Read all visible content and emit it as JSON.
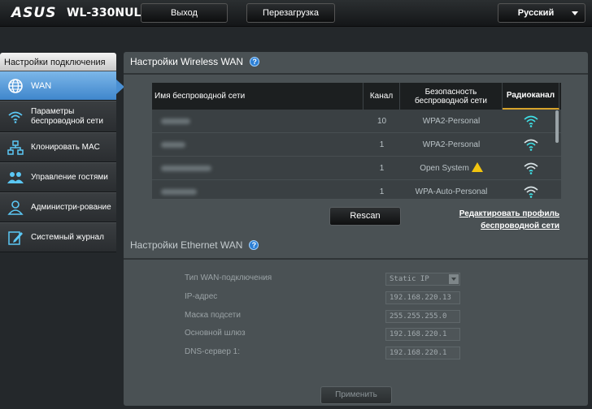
{
  "brand": {
    "logo": "ASUS",
    "model": "WL-330NUL"
  },
  "topbar": {
    "logout": "Выход",
    "reboot": "Перезагрузка",
    "language": "Русский"
  },
  "sidebar": {
    "title": "Настройки подключения",
    "items": [
      {
        "label": "WAN",
        "icon": "globe-icon",
        "active": true
      },
      {
        "label": "Параметры беспроводной сети",
        "icon": "wifi-icon"
      },
      {
        "label": "Клонировать MAC",
        "icon": "network-icon"
      },
      {
        "label": "Управление гостями",
        "icon": "users-icon"
      },
      {
        "label": "Администри-рование",
        "icon": "admin-icon"
      },
      {
        "label": "Системный журнал",
        "icon": "log-icon"
      }
    ]
  },
  "wireless": {
    "title": "Настройки Wireless WAN",
    "columns": [
      "Имя беспроводной сети",
      "Канал",
      "Безопасность беспроводной сети",
      "Радиоканал"
    ],
    "rows": [
      {
        "channel": "10",
        "security": "WPA2-Personal",
        "warning": false
      },
      {
        "channel": "1",
        "security": "WPA2-Personal",
        "warning": false
      },
      {
        "channel": "1",
        "security": "Open System",
        "warning": true
      },
      {
        "channel": "1",
        "security": "WPA-Auto-Personal",
        "warning": false
      }
    ],
    "rescan": "Rescan",
    "edit_link": "Редактировать профиль беспроводной сети"
  },
  "ethernet": {
    "title": "Настройки Ethernet WAN",
    "fields": [
      {
        "label": "Тип WAN-подключения",
        "value": "Static IP",
        "type": "select"
      },
      {
        "label": "IP-адрес",
        "value": "192.168.220.13"
      },
      {
        "label": "Маска подсети",
        "value": "255.255.255.0"
      },
      {
        "label": "Основной шлюз",
        "value": "192.168.220.1"
      },
      {
        "label": "DNS-сервер 1:",
        "value": "192.168.220.1"
      }
    ],
    "apply": "Применить"
  },
  "colors": {
    "accent": "#4a8fd2",
    "signal": "#3fe0e6",
    "warning": "#f1c40f",
    "active_column": "#d7a32b"
  }
}
